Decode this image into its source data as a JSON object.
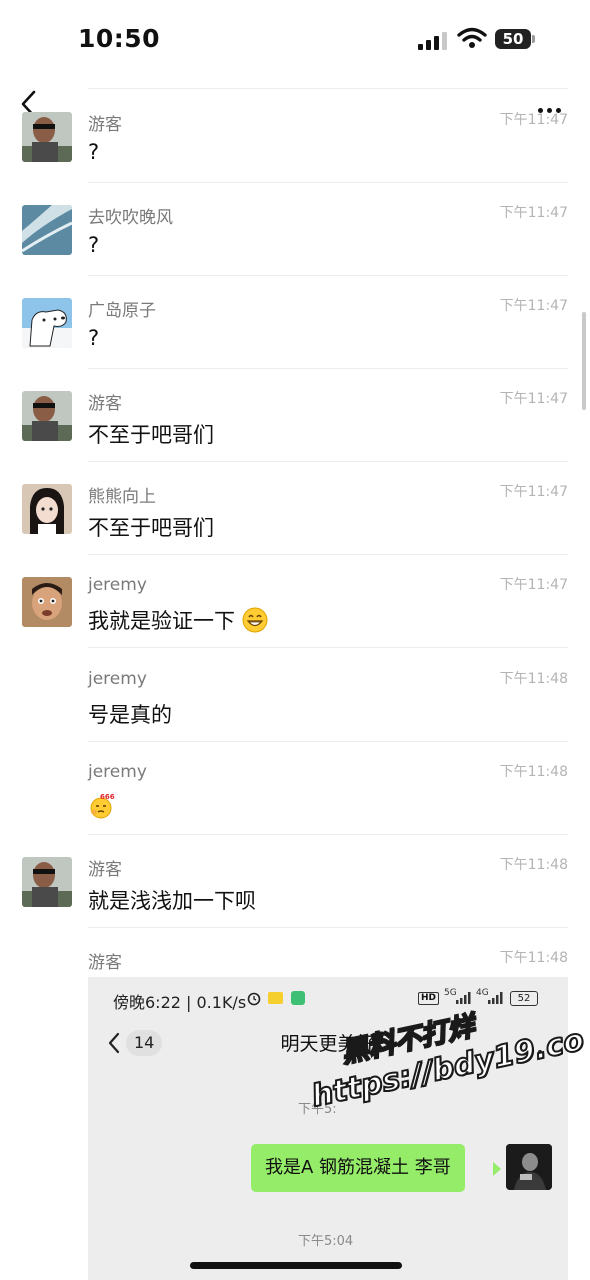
{
  "status_bar": {
    "time": "10:50",
    "battery": "50"
  },
  "header": {
    "back_icon": "chevron-left-icon",
    "more_icon": "more-dots-icon"
  },
  "messages": [
    {
      "name": "游客",
      "time": "下午11:47",
      "text": "?",
      "avatar": "avatar-youke"
    },
    {
      "name": "去吹吹晚风",
      "time": "下午11:47",
      "text": "?",
      "avatar": "avatar-ocean"
    },
    {
      "name": "广岛原子",
      "time": "下午11:47",
      "text": "?",
      "avatar": "avatar-dog"
    },
    {
      "name": "游客",
      "time": "下午11:47",
      "text": "不至于吧哥们",
      "avatar": "avatar-youke"
    },
    {
      "name": "熊熊向上",
      "time": "下午11:47",
      "text": "不至于吧哥们",
      "avatar": "avatar-girl"
    },
    {
      "name": "jeremy",
      "time": "下午11:47",
      "text": "我就是验证一下",
      "emoji": "grin-emoji",
      "avatar": "avatar-jeremy"
    },
    {
      "name": "jeremy",
      "time": "下午11:48",
      "text": "号是真的"
    },
    {
      "name": "jeremy",
      "time": "下午11:48",
      "text": "",
      "emoji": "666-emoji"
    },
    {
      "name": "游客",
      "time": "下午11:48",
      "text": "就是浅浅加一下呗",
      "avatar": "avatar-youke"
    },
    {
      "name": "游客",
      "time": "下午11:48",
      "text": ""
    }
  ],
  "embedded_screenshot": {
    "status_time": "傍晚6:22 | 0.1K/s",
    "hd": "HD",
    "net1": "5G",
    "net2": "4G",
    "battery": "52",
    "unread_count": "14",
    "title": "明天更美好",
    "time1": "下午5:",
    "bubble_text": "我是A 钢筋混凝土 李哥",
    "time2": "下午5:04"
  },
  "watermark": {
    "line1": "黑料不打烊",
    "line2": "https://bdy19.co"
  },
  "colors": {
    "bubble_green": "#95ec69",
    "divider": "#ececec",
    "time_gray": "#b4b4b4"
  }
}
